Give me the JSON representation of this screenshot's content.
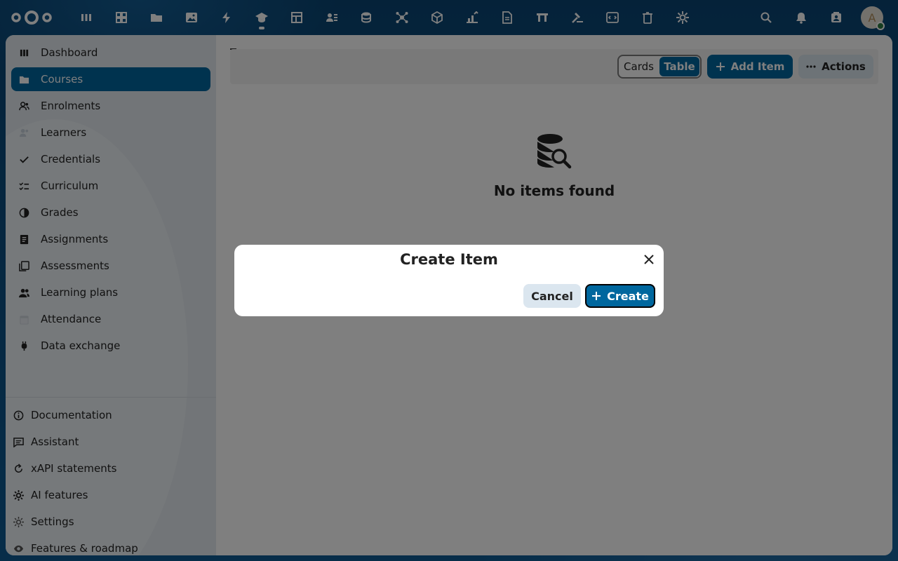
{
  "topbar": {
    "apps": [
      {
        "icon": "dashboard-icon",
        "active": false
      },
      {
        "icon": "apps-grid-icon",
        "active": false
      },
      {
        "icon": "folder-icon",
        "active": false
      },
      {
        "icon": "image-icon",
        "active": false
      },
      {
        "icon": "lightning-icon",
        "active": false
      },
      {
        "icon": "graduation-cap-icon",
        "active": true
      },
      {
        "icon": "table-icon",
        "active": false
      },
      {
        "icon": "contacts-list-icon",
        "active": false
      },
      {
        "icon": "database-icon",
        "active": false
      },
      {
        "icon": "network-icon",
        "active": false
      },
      {
        "icon": "cube-icon",
        "active": false
      },
      {
        "icon": "chart-icon",
        "active": false
      },
      {
        "icon": "document-icon",
        "active": false
      },
      {
        "icon": "whiteboard-icon",
        "active": false
      },
      {
        "icon": "hammer-icon",
        "active": false
      },
      {
        "icon": "code-icon",
        "active": false
      },
      {
        "icon": "trash-icon",
        "active": false
      },
      {
        "icon": "settings-gear-icon",
        "active": false
      }
    ],
    "avatar_letter": "A"
  },
  "sidebar": {
    "items": [
      {
        "label": "Dashboard",
        "icon": "dashboard-icon",
        "active": false
      },
      {
        "label": "Courses",
        "icon": "folder-icon",
        "active": true
      },
      {
        "label": "Enrolments",
        "icon": "users-icon",
        "active": false
      },
      {
        "label": "Learners",
        "icon": "learners-icon",
        "active": false
      },
      {
        "label": "Credentials",
        "icon": "check-icon",
        "active": false
      },
      {
        "label": "Curriculum",
        "icon": "checklist-icon",
        "active": false
      },
      {
        "label": "Grades",
        "icon": "pie-icon",
        "active": false
      },
      {
        "label": "Assignments",
        "icon": "note-icon",
        "active": false
      },
      {
        "label": "Assessments",
        "icon": "copy-icon",
        "active": false
      },
      {
        "label": "Learning plans",
        "icon": "people-icon",
        "active": false
      },
      {
        "label": "Attendance",
        "icon": "calendar-icon",
        "active": false
      },
      {
        "label": "Data exchange",
        "icon": "plug-icon",
        "active": false
      }
    ],
    "bottom_items": [
      {
        "label": "Documentation",
        "icon": "info-icon"
      },
      {
        "label": "Assistant",
        "icon": "chat-icon"
      },
      {
        "label": "xAPI statements",
        "icon": "refresh-icon"
      },
      {
        "label": "AI features",
        "icon": "cog-icon"
      },
      {
        "label": "Settings",
        "icon": "settings-icon"
      },
      {
        "label": "Features & roadmap",
        "icon": "eye-icon"
      }
    ]
  },
  "toolbar": {
    "view_cards": "Cards",
    "view_table": "Table",
    "add_item": "Add Item",
    "actions": "Actions"
  },
  "empty_state": {
    "message": "No items found"
  },
  "modal": {
    "title": "Create Item",
    "cancel": "Cancel",
    "create": "Create"
  },
  "colors": {
    "primary": "#00679e",
    "header_bg": "#0b4a78"
  }
}
